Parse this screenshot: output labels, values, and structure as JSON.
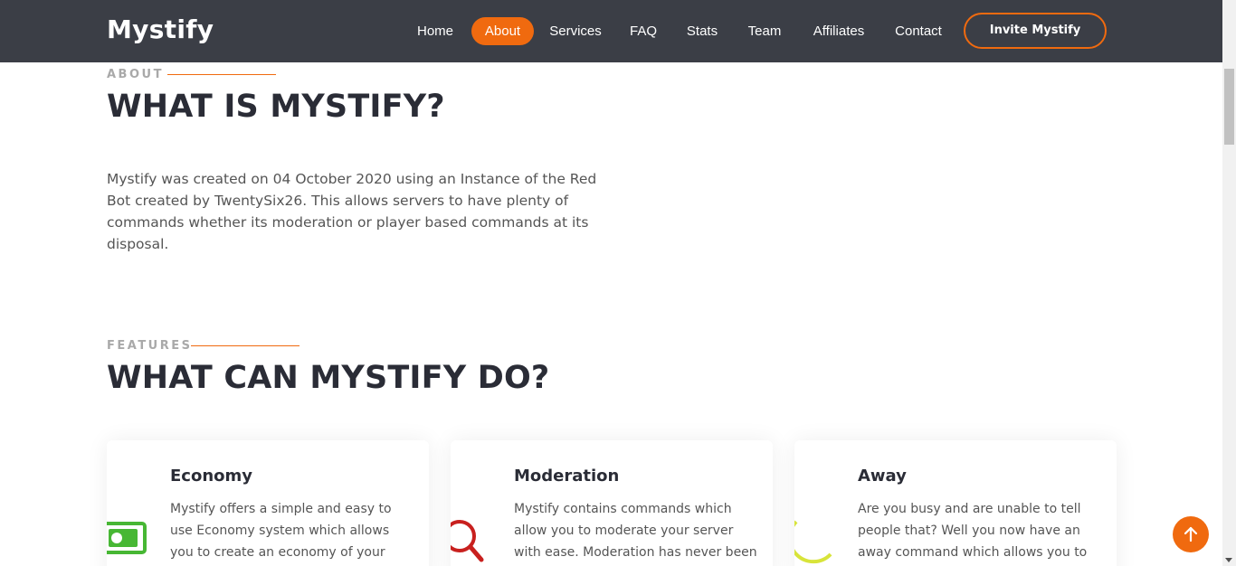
{
  "brand": {
    "name": "Mystify"
  },
  "nav": {
    "items": [
      {
        "label": "Home",
        "active": false
      },
      {
        "label": "About",
        "active": true
      },
      {
        "label": "Services",
        "active": false
      },
      {
        "label": "FAQ",
        "active": false
      },
      {
        "label": "Stats",
        "active": false
      },
      {
        "label": "Team",
        "active": false
      },
      {
        "label": "Affiliates",
        "active": false
      },
      {
        "label": "Contact",
        "active": false
      }
    ],
    "cta_label": "Invite Mystify"
  },
  "about": {
    "kicker": "ABOUT",
    "heading": "WHAT IS MYSTIFY?",
    "text": "Mystify was created on 04 October 2020 using an Instance of the Red Bot created by TwentySix26. This allows servers to have plenty of commands whether its moderation or player based commands at its disposal."
  },
  "features": {
    "kicker": "FEATURES",
    "heading": "WHAT CAN MYSTIFY DO?",
    "cards": [
      {
        "title": "Economy",
        "text": "Mystify offers a simple and easy to use Economy system which allows you to create an economy of your choice like",
        "icon": "money-icon",
        "icon_color": "#47b734"
      },
      {
        "title": "Moderation",
        "text": "Mystify contains commands which allow you to moderate your server with ease. Moderation has never been",
        "icon": "magnifier-icon",
        "icon_color": "#c8201e"
      },
      {
        "title": "Away",
        "text": "Are you busy and are unable to tell people that? Well you now have an away command which allows you to",
        "icon": "moon-icon",
        "icon_color": "#d8e43a"
      }
    ]
  },
  "colors": {
    "accent": "#f06a0f",
    "header_bg": "#3b3e46",
    "heading": "#2a2c36"
  }
}
